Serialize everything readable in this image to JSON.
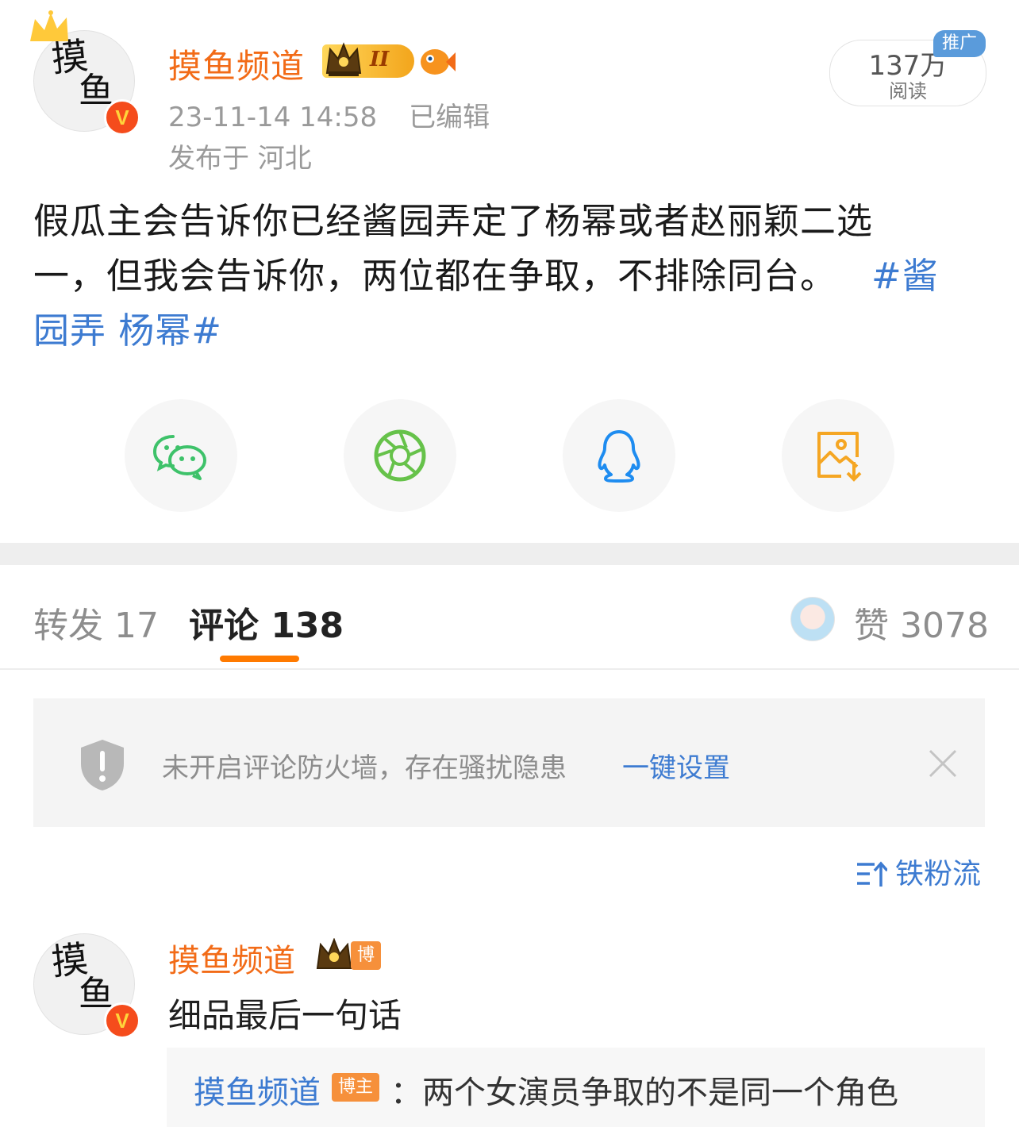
{
  "post": {
    "author": "摸鱼频道",
    "level_badge": "II",
    "timestamp": "23-11-14 14:58",
    "edited_label": "已编辑",
    "location": "发布于 河北",
    "reads_count": "137万",
    "reads_label": "阅读",
    "promo_label": "推广",
    "text_line1": "假瓜主会告诉你已经酱园弄定了杨幂或者赵丽颖二选",
    "text_line2_plain": "一，但我会告诉你，两位都在争取，不排除同台。",
    "text_line2_tag": "#酱",
    "text_line3_tag": "园弄 杨幂#"
  },
  "share_buttons": [
    {
      "name": "wechat-icon",
      "color": "#3ec26a"
    },
    {
      "name": "moments-icon",
      "color": "#66c24a"
    },
    {
      "name": "qq-icon",
      "color": "#1e8cf0"
    },
    {
      "name": "save-image-icon",
      "color": "#f5a623"
    }
  ],
  "tabs": {
    "repost": "转发 17",
    "comments": "评论 138",
    "likes": "赞 3078",
    "active_color": "#ff7a00"
  },
  "notice": {
    "message": "未开启评论防火墙，存在骚扰隐患",
    "action": "一键设置"
  },
  "sort": {
    "label": "铁粉流"
  },
  "comment": {
    "author": "摸鱼频道",
    "tag": "博主",
    "text": "细品最后一句话",
    "reply": {
      "author": "摸鱼频道",
      "tag": "博主",
      "text": "：两个女演员争取的不是同一个角色"
    }
  },
  "colors": {
    "name_orange": "#f26b17",
    "link_blue": "#3d7bd1",
    "verified_red": "#f54c1c"
  }
}
